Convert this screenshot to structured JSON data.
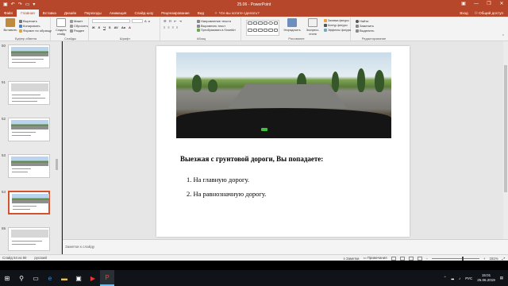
{
  "title": "25.06 - PowerPoint",
  "window_controls": [
    "—",
    "❐",
    "✕"
  ],
  "tabs": [
    "Файл",
    "Главная",
    "Вставка",
    "Дизайн",
    "Переходы",
    "Анимация",
    "Слайд-шоу",
    "Рецензирование",
    "Вид"
  ],
  "active_tab_index": 1,
  "tell_me": "Что вы хотите сделать?",
  "signin": "Вход",
  "share": "Общий доступ",
  "ribbon": {
    "clipboard": {
      "paste": "Вставить",
      "cut": "Вырезать",
      "copy": "Копировать",
      "format": "Формат по образцу",
      "label": "Буфер обмена"
    },
    "slides": {
      "new_slide": "Создать слайд",
      "layout": "Макет",
      "reset": "Сбросить",
      "section": "Раздел",
      "label": "Слайды"
    },
    "font": {
      "label": "Шрифт"
    },
    "paragraph": {
      "text_direction": "Направление текста",
      "align_text": "Выровнять текст",
      "smartart": "Преобразовать в SmartArt",
      "label": "Абзац"
    },
    "drawing": {
      "arrange": "Упорядочить",
      "quick_styles": "Экспресс-стили",
      "fill": "Заливка фигуры",
      "outline": "Контур фигуры",
      "effects": "Эффекты фигуры",
      "label": "Рисование"
    },
    "editing": {
      "find": "Найти",
      "replace": "Заменить",
      "select": "Выделить",
      "label": "Редактирование"
    }
  },
  "thumbnails": [
    {
      "num": "50"
    },
    {
      "num": "51"
    },
    {
      "num": "52"
    },
    {
      "num": "53"
    },
    {
      "num": "54",
      "selected": true
    },
    {
      "num": "55"
    }
  ],
  "slide": {
    "question": "Выезжая с грунтовой дороги, Вы попадаете:",
    "answers": [
      "1. На главную дорогу.",
      "2. На равнозначную дорогу."
    ]
  },
  "notes_placeholder": "Заметки к слайду",
  "status": {
    "slide_info": "Слайд 54 из 90",
    "language": "русский",
    "notes": "Заметки",
    "comments": "Примечания",
    "zoom": "151%"
  },
  "taskbar": {
    "lang": "РУС",
    "time": "15:01",
    "date": "25.06.2019"
  }
}
